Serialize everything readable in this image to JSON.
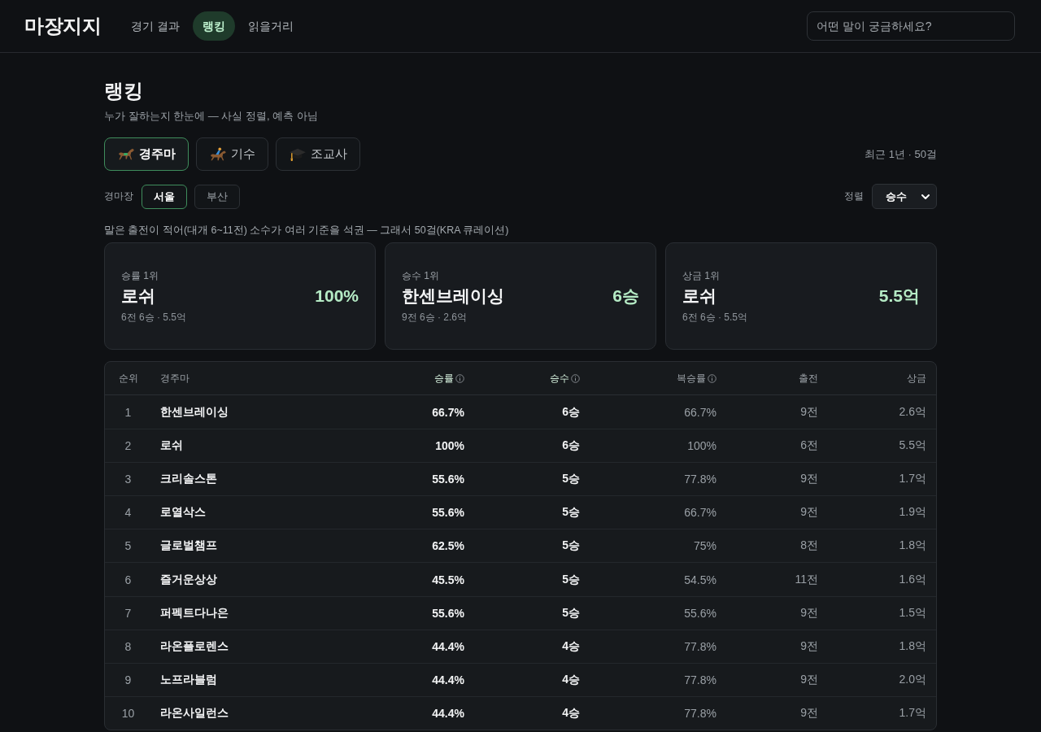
{
  "header": {
    "logo": "마장지지",
    "nav": [
      {
        "label": "경기 결과",
        "selected": false
      },
      {
        "label": "랭킹",
        "selected": true
      },
      {
        "label": "읽을거리",
        "selected": false
      }
    ],
    "search": {
      "placeholder": "어떤 말이 궁금하세요?"
    }
  },
  "page": {
    "title": "랭킹",
    "subtitle": "누가 잘하는지 한눈에 — 사실 정렬, 예측 아님"
  },
  "category_tabs": [
    {
      "kind": "horse",
      "label": "경주마",
      "selected": true
    },
    {
      "kind": "jockey",
      "label": "기수",
      "selected": false
    },
    {
      "kind": "trainer",
      "label": "조교사",
      "selected": false
    }
  ],
  "period": "최근 1년 · 50걸",
  "venue": {
    "label": "경마장",
    "options": [
      {
        "label": "서울",
        "selected": true
      },
      {
        "label": "부산",
        "selected": false
      }
    ]
  },
  "sort": {
    "label": "정렬",
    "value": "승수"
  },
  "note": "말은 출전이 적어(대개 6~11전) 소수가 여러 기준을 석권 — 그래서 50걸(KRA 큐레이션)",
  "highlight_cards": [
    {
      "label": "승률 1위",
      "name": "로쉬",
      "value": "100%",
      "detail": "6전 6승 · 5.5억"
    },
    {
      "label": "승수 1위",
      "name": "한센브레이싱",
      "value": "6승",
      "detail": "9전 6승 · 2.6억"
    },
    {
      "label": "상금 1위",
      "name": "로쉬",
      "value": "5.5억",
      "detail": "6전 6승 · 5.5억"
    }
  ],
  "table": {
    "columns": [
      {
        "label": "순위",
        "highlighted": false,
        "info_icon": false
      },
      {
        "label": "경주마",
        "highlighted": false,
        "info_icon": false
      },
      {
        "label": "승률",
        "highlighted": true,
        "info_icon": true
      },
      {
        "label": "승수",
        "highlighted": true,
        "info_icon": true
      },
      {
        "label": "복승률",
        "highlighted": false,
        "info_icon": true
      },
      {
        "label": "출전",
        "highlighted": false,
        "info_icon": false
      },
      {
        "label": "상금",
        "highlighted": false,
        "info_icon": false
      }
    ],
    "rows": [
      {
        "cells": [
          "1",
          "한센브레이싱",
          "66.7%",
          "6승",
          "66.7%",
          "9전",
          "2.6억"
        ]
      },
      {
        "cells": [
          "2",
          "로쉬",
          "100%",
          "6승",
          "100%",
          "6전",
          "5.5억"
        ]
      },
      {
        "cells": [
          "3",
          "크리솔스톤",
          "55.6%",
          "5승",
          "77.8%",
          "9전",
          "1.7억"
        ]
      },
      {
        "cells": [
          "4",
          "로열삭스",
          "55.6%",
          "5승",
          "66.7%",
          "9전",
          "1.9억"
        ]
      },
      {
        "cells": [
          "5",
          "글로벌챔프",
          "62.5%",
          "5승",
          "75%",
          "8전",
          "1.8억"
        ]
      },
      {
        "cells": [
          "6",
          "즐거운상상",
          "45.5%",
          "5승",
          "54.5%",
          "11전",
          "1.6억"
        ]
      },
      {
        "cells": [
          "7",
          "퍼펙트다나은",
          "55.6%",
          "5승",
          "55.6%",
          "9전",
          "1.5억"
        ]
      },
      {
        "cells": [
          "8",
          "라온플로렌스",
          "44.4%",
          "4승",
          "77.8%",
          "9전",
          "1.8억"
        ]
      },
      {
        "cells": [
          "9",
          "노프라블럼",
          "44.4%",
          "4승",
          "77.8%",
          "9전",
          "2.0억"
        ]
      },
      {
        "cells": [
          "10",
          "라온사일런스",
          "44.4%",
          "4승",
          "77.8%",
          "9전",
          "1.7억"
        ]
      }
    ]
  }
}
